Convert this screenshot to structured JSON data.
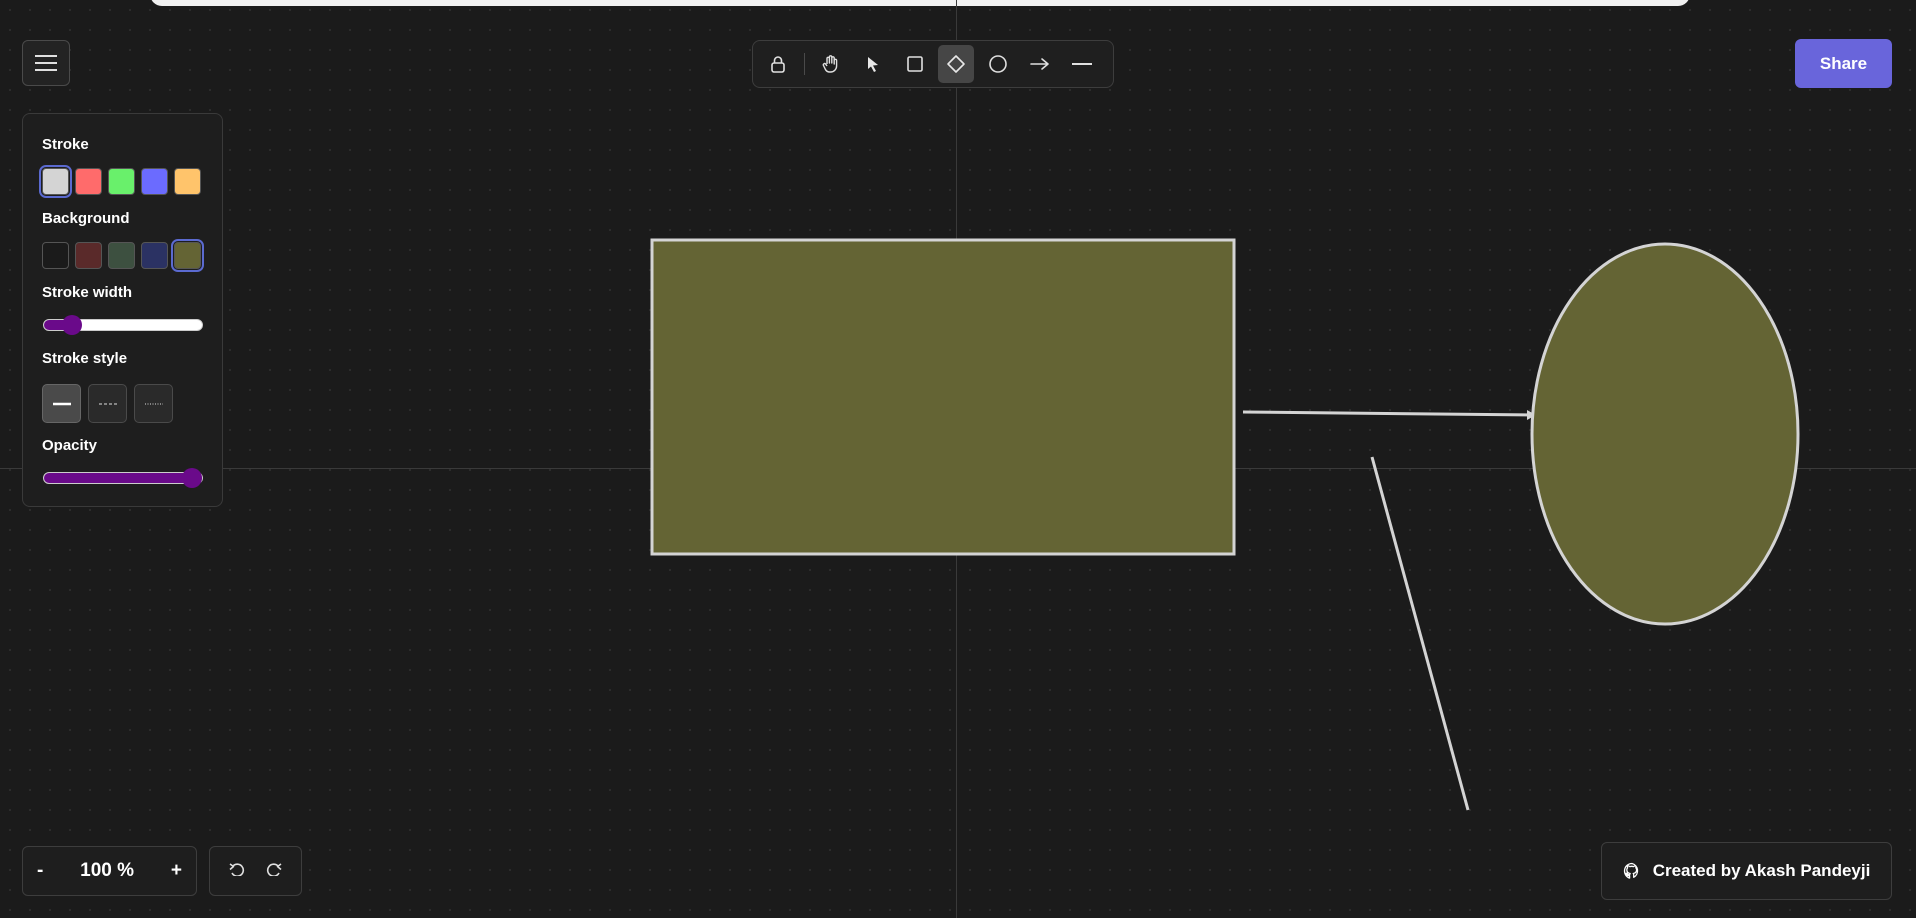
{
  "toolbar": {
    "tools": [
      {
        "name": "lock",
        "icon": "lock-icon"
      },
      {
        "name": "hand",
        "icon": "hand-icon"
      },
      {
        "name": "select",
        "icon": "pointer-icon"
      },
      {
        "name": "rectangle",
        "icon": "square-icon"
      },
      {
        "name": "diamond",
        "icon": "diamond-icon",
        "active": true
      },
      {
        "name": "ellipse",
        "icon": "circle-icon"
      },
      {
        "name": "arrow",
        "icon": "arrow-right-icon"
      },
      {
        "name": "line",
        "icon": "line-icon"
      }
    ]
  },
  "share": {
    "label": "Share"
  },
  "properties": {
    "stroke_label": "Stroke",
    "stroke_colors": [
      "#d4d4d4",
      "#ff6b6b",
      "#69f06b",
      "#6b6bff",
      "#ffc46b"
    ],
    "stroke_selected": 0,
    "background_label": "Background",
    "background_colors": [
      "#1b1b1b",
      "#5a2a2a",
      "#3d5040",
      "#2b3263",
      "#646434"
    ],
    "background_selected": 4,
    "stroke_width_label": "Stroke width",
    "stroke_width_value": 0.18,
    "stroke_style_label": "Stroke style",
    "stroke_styles": [
      "solid",
      "dashed",
      "dotted"
    ],
    "stroke_style_selected": "solid",
    "opacity_label": "Opacity",
    "opacity_value": 1.0
  },
  "zoom": {
    "minus": "-",
    "level": "100 %",
    "plus": "+"
  },
  "history": {
    "undo_icon": "undo-icon",
    "redo_icon": "redo-icon"
  },
  "credit": {
    "label": "Created by Akash Pandeyji",
    "icon": "github-icon"
  },
  "canvas": {
    "element_fill": "#646434",
    "element_stroke": "#d4d4d4",
    "elements": [
      "rectangle",
      "arrow",
      "line",
      "ellipse"
    ]
  }
}
